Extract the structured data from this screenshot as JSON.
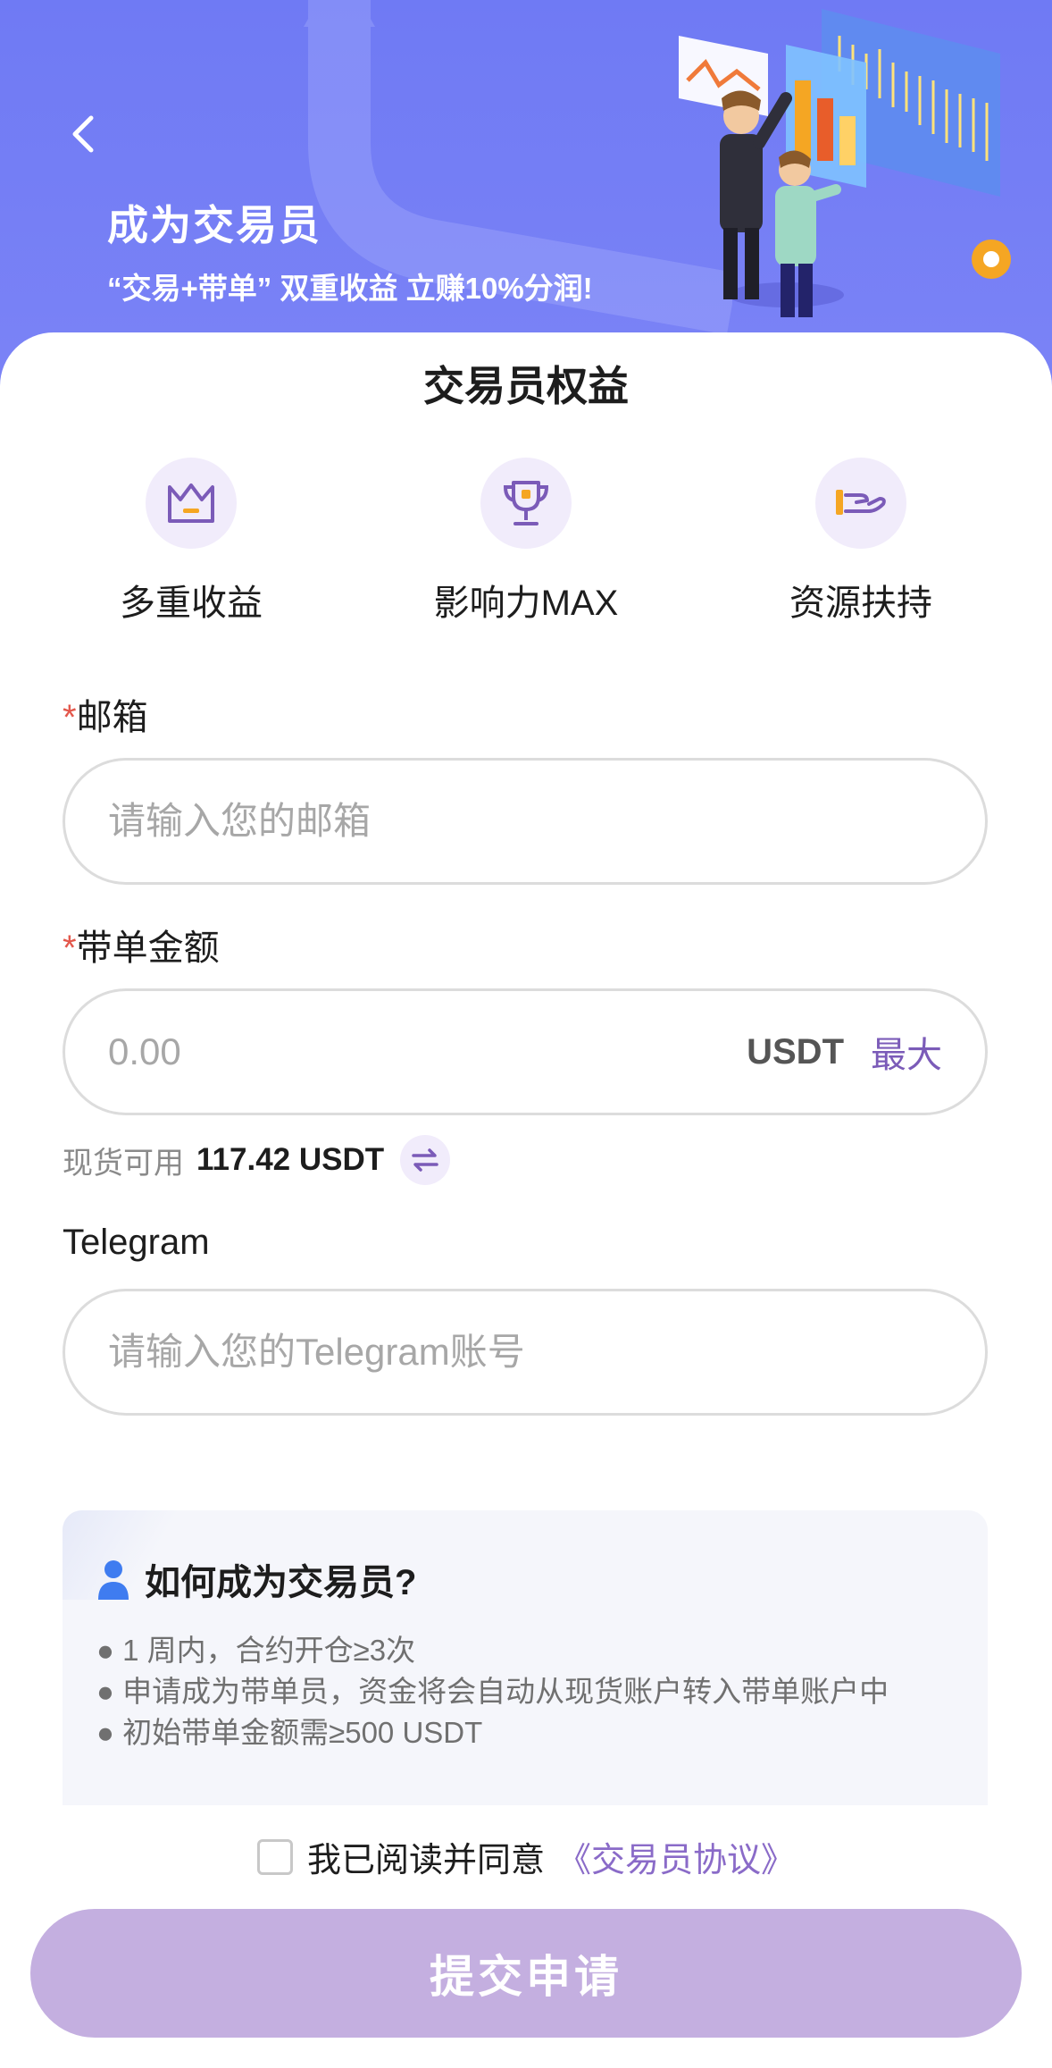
{
  "header": {
    "title": "成为交易员",
    "subtitle": "“交易+带单” 双重收益 立赚10%分润!"
  },
  "benefits": {
    "title": "交易员权益",
    "items": [
      {
        "label": "多重收益",
        "icon": "crown-icon"
      },
      {
        "label": "影响力MAX",
        "icon": "trophy-icon"
      },
      {
        "label": "资源扶持",
        "icon": "support-hand-icon"
      }
    ]
  },
  "form": {
    "required_mark": "*",
    "email": {
      "label": "邮箱",
      "placeholder": "请输入您的邮箱",
      "value": ""
    },
    "amount": {
      "label": "带单金额",
      "placeholder": "0.00",
      "value": "",
      "unit": "USDT",
      "max_label": "最大"
    },
    "available": {
      "label": "现货可用",
      "value": "117.42 USDT"
    },
    "telegram": {
      "label": "Telegram",
      "placeholder": "请输入您的Telegram账号",
      "value": ""
    }
  },
  "howto": {
    "title": "如何成为交易员?",
    "items": [
      "● 1 周内，合约开仓≥3次",
      "● 申请成为带单员，资金将会自动从现货账户转入带单账户中",
      "● 初始带单金额需≥500 USDT"
    ]
  },
  "agreement": {
    "checked": false,
    "text": "我已阅读并同意",
    "link": "《交易员协议》"
  },
  "submit": {
    "label": "提交申请"
  },
  "colors": {
    "hero": "#6f7af4",
    "accent": "#7b5bb8",
    "submit_disabled": "#c4afe0",
    "required": "#e3574b"
  }
}
